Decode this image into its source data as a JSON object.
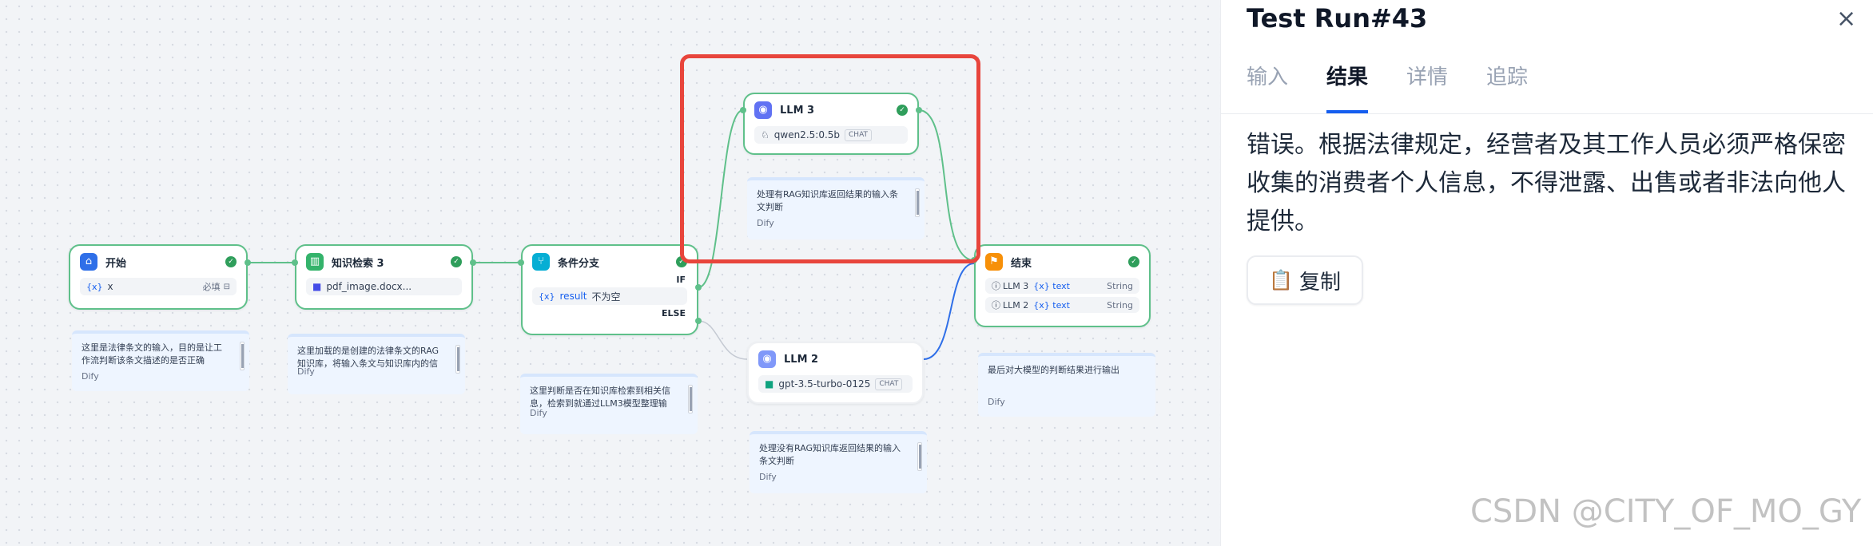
{
  "nodes": {
    "start": {
      "title": "开始",
      "var_tag": "{x}",
      "var_name": "x",
      "required": "必填"
    },
    "knowledge": {
      "title": "知识检索 3",
      "file": "pdf_image.docx..."
    },
    "branch": {
      "title": "条件分支",
      "if_label": "IF",
      "var_tag": "{x}",
      "var_name": "result",
      "condition": "不为空",
      "else_label": "ELSE"
    },
    "llm3": {
      "title": "LLM 3",
      "model": "qwen2.5:0.5b",
      "mode": "CHAT"
    },
    "llm2": {
      "title": "LLM 2",
      "model": "gpt-3.5-turbo-0125",
      "mode": "CHAT"
    },
    "end": {
      "title": "结束",
      "rows": [
        {
          "source": "LLM 3",
          "var": "{x} text",
          "type": "String"
        },
        {
          "source": "LLM 2",
          "var": "{x} text",
          "type": "String"
        }
      ]
    }
  },
  "notes": {
    "start": {
      "text": "这里是法律条文的输入，目的是让工作流判断该条文描述的是否正确",
      "author": "Dify"
    },
    "knowledge": {
      "text": "这里加载的是创建的法律条文的RAG知识库，将输入条文与知识库内的信",
      "author": "Dify"
    },
    "branch": {
      "text": "这里判断是否在知识库检索到相关信息，检索到就通过LLM3模型整理输",
      "author": "Dify"
    },
    "llm3": {
      "text": "处理有RAG知识库返回结果的输入条文判断",
      "author": "Dify"
    },
    "llm2": {
      "text": "处理没有RAG知识库返回结果的输入条文判断",
      "author": "Dify"
    },
    "end": {
      "text": "最后对大模型的判断结果进行输出",
      "author": "Dify"
    }
  },
  "panel": {
    "title": "Test Run#43",
    "close": "×",
    "tabs": [
      {
        "label": "输入",
        "active": false
      },
      {
        "label": "结果",
        "active": true
      },
      {
        "label": "详情",
        "active": false
      },
      {
        "label": "追踪",
        "active": false
      }
    ],
    "result_text": "错误。根据法律规定，经营者及其工作人员必须严格保密收集的消费者个人信息，不得泄露、出售或者非法向他人提供。",
    "copy_label": "复制"
  },
  "watermark": "CSDN @CITY_OF_MO_GY",
  "colors": {
    "success": "#2f9e5b",
    "edge": "#5fc08a",
    "highlight": "#e8453c",
    "accent": "#155eef"
  }
}
